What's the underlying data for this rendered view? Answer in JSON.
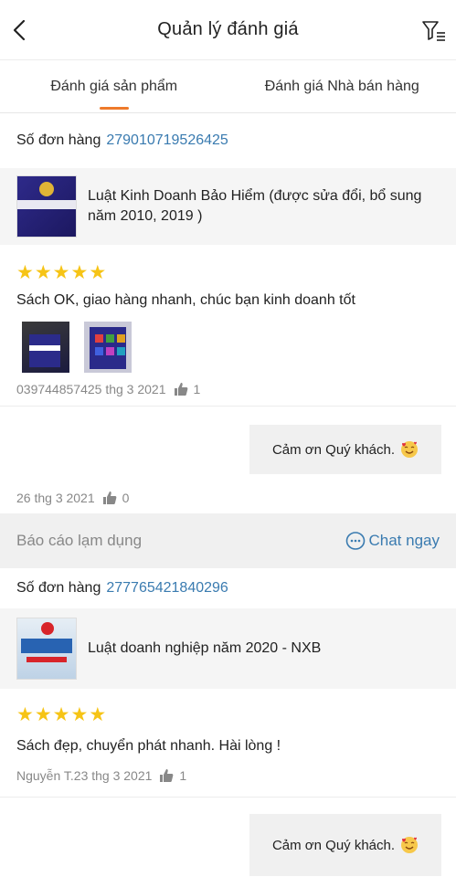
{
  "header": {
    "title": "Quản lý đánh giá"
  },
  "tabs": [
    {
      "label": "Đánh giá sản phẩm",
      "active": true
    },
    {
      "label": "Đánh giá Nhà bán hàng",
      "active": false
    }
  ],
  "colors": {
    "accent": "#ee7a2b",
    "link": "#3a7bb0",
    "star": "#f6c416"
  },
  "orders": [
    {
      "order_label": "Số đơn hàng",
      "order_number": "279010719526425",
      "product_name": "Luật Kinh Doanh Bảo Hiểm (được sửa đổi, bổ sung năm 2010, 2019 )",
      "rating": 5,
      "comment": "Sách OK, giao hàng nhanh, chúc bạn kinh doanh tốt",
      "meta": "039744857425 thg 3 2021",
      "likes": "1",
      "reply": "Cảm ơn Quý khách.",
      "reply_meta": "26 thg 3 2021",
      "reply_likes": "0"
    },
    {
      "order_label": "Số đơn hàng",
      "order_number": "277765421840296",
      "product_name": "Luật doanh nghiệp năm 2020 - NXB",
      "rating": 5,
      "comment": "Sách đẹp, chuyển phát nhanh. Hài lòng !",
      "meta": "Nguyễn T.23 thg 3 2021",
      "likes": "1",
      "reply": "Cảm ơn Quý khách."
    }
  ],
  "actions": {
    "report": "Báo cáo lạm dụng",
    "chat": "Chat ngay"
  }
}
